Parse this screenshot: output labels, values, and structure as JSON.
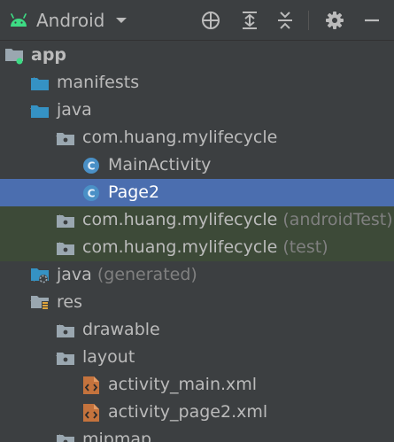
{
  "toolbar": {
    "view_label": "Android",
    "buttons": [
      {
        "name": "locate-icon"
      },
      {
        "name": "expand-all-icon"
      },
      {
        "name": "collapse-all-icon"
      },
      {
        "name": "settings-icon"
      },
      {
        "name": "hide-icon"
      }
    ]
  },
  "tree": {
    "rows": [
      {
        "name": "tree-node-app",
        "label": "app",
        "suffix": "",
        "arrow": "none",
        "icon": "module-icon",
        "bold": true,
        "state": "normal"
      },
      {
        "name": "tree-node-manifests",
        "label": "manifests",
        "suffix": "",
        "arrow": "right",
        "icon": "folder-icon",
        "bold": false,
        "state": "normal"
      },
      {
        "name": "tree-node-java",
        "label": "java",
        "suffix": "",
        "arrow": "down",
        "icon": "folder-icon",
        "bold": false,
        "state": "normal"
      },
      {
        "name": "tree-node-package-main",
        "label": "com.huang.mylifecycle",
        "suffix": "",
        "arrow": "down",
        "icon": "package-icon",
        "bold": false,
        "state": "normal"
      },
      {
        "name": "tree-node-mainactivity",
        "label": "MainActivity",
        "suffix": "",
        "arrow": "none",
        "icon": "class-icon",
        "bold": false,
        "state": "normal"
      },
      {
        "name": "tree-node-page2",
        "label": "Page2",
        "suffix": "",
        "arrow": "none",
        "icon": "class-icon",
        "bold": false,
        "state": "selected"
      },
      {
        "name": "tree-node-package-androidtest",
        "label": "com.huang.mylifecycle",
        "suffix": " (androidTest)",
        "arrow": "right",
        "icon": "package-icon",
        "bold": false,
        "state": "scope"
      },
      {
        "name": "tree-node-package-test",
        "label": "com.huang.mylifecycle",
        "suffix": " (test)",
        "arrow": "right",
        "icon": "package-icon",
        "bold": false,
        "state": "scope"
      },
      {
        "name": "tree-node-java-generated",
        "label": "java",
        "suffix": " (generated)",
        "arrow": "right",
        "icon": "generated-folder-icon",
        "bold": false,
        "state": "normal"
      },
      {
        "name": "tree-node-res",
        "label": "res",
        "suffix": "",
        "arrow": "down",
        "icon": "resources-folder-icon",
        "bold": false,
        "state": "normal"
      },
      {
        "name": "tree-node-drawable",
        "label": "drawable",
        "suffix": "",
        "arrow": "right",
        "icon": "package-icon",
        "bold": false,
        "state": "normal"
      },
      {
        "name": "tree-node-layout",
        "label": "layout",
        "suffix": "",
        "arrow": "down",
        "icon": "package-icon",
        "bold": false,
        "state": "normal"
      },
      {
        "name": "tree-node-activity-main-xml",
        "label": "activity_main.xml",
        "suffix": "",
        "arrow": "none",
        "icon": "layout-file-icon",
        "bold": false,
        "state": "normal"
      },
      {
        "name": "tree-node-activity-page2-xml",
        "label": "activity_page2.xml",
        "suffix": "",
        "arrow": "none",
        "icon": "layout-file-icon",
        "bold": false,
        "state": "normal"
      },
      {
        "name": "tree-node-mipmap",
        "label": "mipmap",
        "suffix": "",
        "arrow": "right",
        "icon": "package-icon",
        "bold": false,
        "state": "normal"
      }
    ]
  },
  "colors": {
    "background": "#3c3f41",
    "selection": "#4b6eaf",
    "scope_highlight": "#3d4a38",
    "text": "#bbbbbb",
    "suffix_text": "#808080",
    "folder_blue": "#3592c4",
    "android_green": "#3ddc84",
    "class_badge": "#4a90c6"
  }
}
